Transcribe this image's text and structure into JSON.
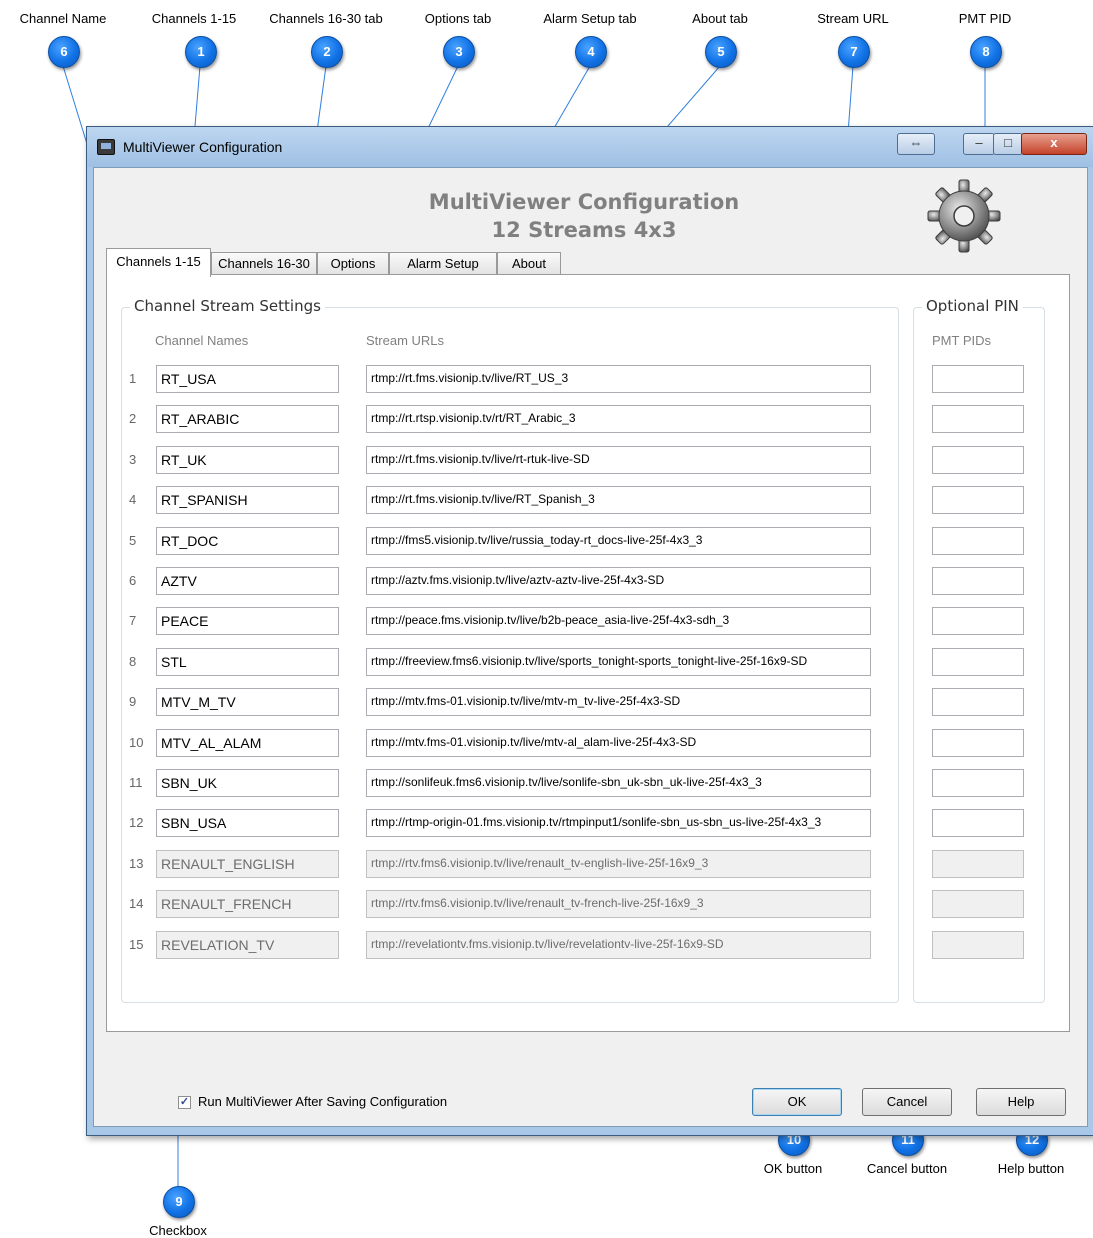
{
  "callouts": [
    {
      "num": "6",
      "label": "Channel Name"
    },
    {
      "num": "1",
      "label": "Channels 1-15"
    },
    {
      "num": "2",
      "label": "Channels 16-30 tab"
    },
    {
      "num": "3",
      "label": "Options tab"
    },
    {
      "num": "4",
      "label": "Alarm Setup tab"
    },
    {
      "num": "5",
      "label": "About tab"
    },
    {
      "num": "7",
      "label": "Stream URL"
    },
    {
      "num": "8",
      "label": "PMT PID"
    },
    {
      "num": "9",
      "label": "Checkbox"
    },
    {
      "num": "10",
      "label": "OK button"
    },
    {
      "num": "11",
      "label": "Cancel button"
    },
    {
      "num": "12",
      "label": "Help button"
    }
  ],
  "window": {
    "title": "MultiViewer Configuration",
    "header_line1": "MultiViewer Configuration",
    "header_line2": "12 Streams 4x3",
    "titlebar_buttons": {
      "resize": "⇔",
      "minimize": "–",
      "maximize": "□",
      "close": "x"
    }
  },
  "tabs": [
    "Channels 1-15",
    "Channels 16-30",
    "Options",
    "Alarm Setup",
    "About"
  ],
  "active_tab": "Channels 1-15",
  "channel_group": {
    "title": "Channel Stream Settings",
    "col_names": "Channel Names",
    "col_urls": "Stream URLs"
  },
  "pin_group": {
    "title": "Optional PIN",
    "col_pids": "PMT PIDs"
  },
  "rows": [
    {
      "num": "1",
      "name": "RT_USA",
      "url": "rtmp://rt.fms.visionip.tv/live/RT_US_3",
      "pid": "",
      "enabled": true
    },
    {
      "num": "2",
      "name": "RT_ARABIC",
      "url": "rtmp://rt.rtsp.visionip.tv/rt/RT_Arabic_3",
      "pid": "",
      "enabled": true
    },
    {
      "num": "3",
      "name": "RT_UK",
      "url": "rtmp://rt.fms.visionip.tv/live/rt-rtuk-live-SD",
      "pid": "",
      "enabled": true
    },
    {
      "num": "4",
      "name": "RT_SPANISH",
      "url": "rtmp://rt.fms.visionip.tv/live/RT_Spanish_3",
      "pid": "",
      "enabled": true
    },
    {
      "num": "5",
      "name": "RT_DOC",
      "url": "rtmp://fms5.visionip.tv/live/russia_today-rt_docs-live-25f-4x3_3",
      "pid": "",
      "enabled": true
    },
    {
      "num": "6",
      "name": "AZTV",
      "url": "rtmp://aztv.fms.visionip.tv/live/aztv-aztv-live-25f-4x3-SD",
      "pid": "",
      "enabled": true
    },
    {
      "num": "7",
      "name": "PEACE",
      "url": "rtmp://peace.fms.visionip.tv/live/b2b-peace_asia-live-25f-4x3-sdh_3",
      "pid": "",
      "enabled": true
    },
    {
      "num": "8",
      "name": "STL",
      "url": "rtmp://freeview.fms6.visionip.tv/live/sports_tonight-sports_tonight-live-25f-16x9-SD",
      "pid": "",
      "enabled": true
    },
    {
      "num": "9",
      "name": "MTV_M_TV",
      "url": "rtmp://mtv.fms-01.visionip.tv/live/mtv-m_tv-live-25f-4x3-SD",
      "pid": "",
      "enabled": true
    },
    {
      "num": "10",
      "name": "MTV_AL_ALAM",
      "url": "rtmp://mtv.fms-01.visionip.tv/live/mtv-al_alam-live-25f-4x3-SD",
      "pid": "",
      "enabled": true
    },
    {
      "num": "11",
      "name": "SBN_UK",
      "url": "rtmp://sonlifeuk.fms6.visionip.tv/live/sonlife-sbn_uk-sbn_uk-live-25f-4x3_3",
      "pid": "",
      "enabled": true
    },
    {
      "num": "12",
      "name": "SBN_USA",
      "url": "rtmp://rtmp-origin-01.fms.visionip.tv/rtmpinput1/sonlife-sbn_us-sbn_us-live-25f-4x3_3",
      "pid": "",
      "enabled": true
    },
    {
      "num": "13",
      "name": "RENAULT_ENGLISH",
      "url": "rtmp://rtv.fms6.visionip.tv/live/renault_tv-english-live-25f-16x9_3",
      "pid": "",
      "enabled": false
    },
    {
      "num": "14",
      "name": "RENAULT_FRENCH",
      "url": "rtmp://rtv.fms6.visionip.tv/live/renault_tv-french-live-25f-16x9_3",
      "pid": "",
      "enabled": false
    },
    {
      "num": "15",
      "name": "REVELATION_TV",
      "url": "rtmp://revelationtv.fms.visionip.tv/live/revelationtv-live-25f-16x9-SD",
      "pid": "",
      "enabled": false
    }
  ],
  "footer": {
    "checkbox_label": "Run MultiViewer After Saving Configuration",
    "checkbox_checked": true,
    "ok_label": "OK",
    "cancel_label": "Cancel",
    "help_label": "Help"
  },
  "colors": {
    "bubble": "#1172e6",
    "leader": "#2f7fe0",
    "window_frame": "#a9c7e6"
  }
}
